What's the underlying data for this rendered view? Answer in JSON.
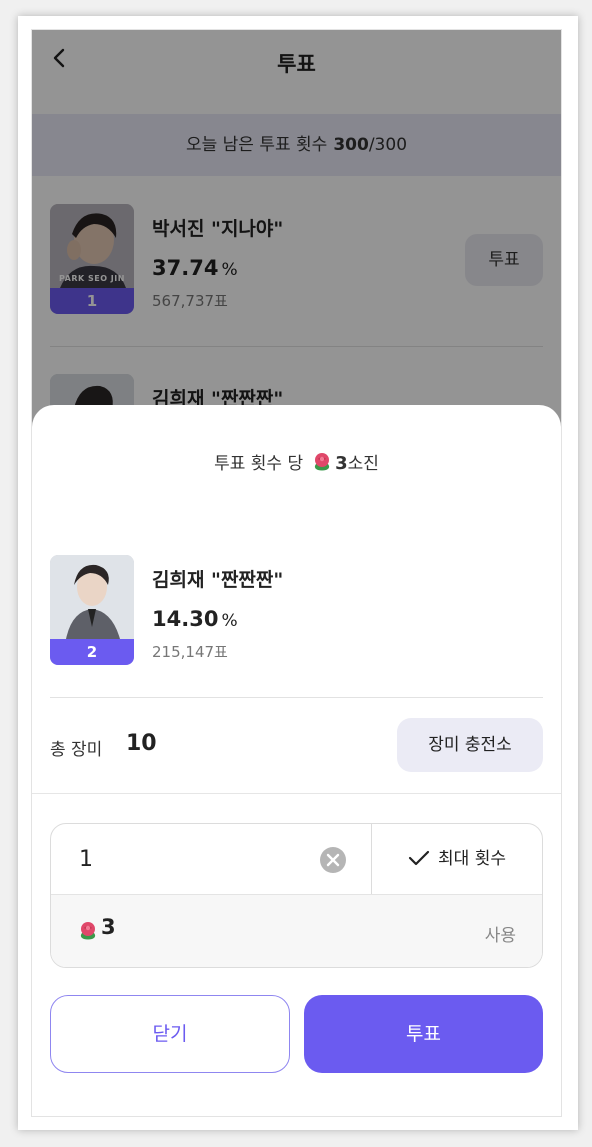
{
  "header": {
    "title": "투표"
  },
  "remaining": {
    "label": "오늘 남은 투표 횟수",
    "count": "300",
    "total": "/300"
  },
  "candidates": [
    {
      "name": "박서진 \"지나야\"",
      "percent": "37.74",
      "unit": "%",
      "votes": "567,737표",
      "rank": "1",
      "caption": "PARK SEO JIN",
      "vote_label": "투표"
    },
    {
      "name": "김희재 \"짠짠짠\"",
      "percent": "14.30",
      "unit": "%",
      "votes": "215,147표",
      "rank": "2"
    }
  ],
  "sheet": {
    "cost_prefix": "투표 횟수 당",
    "cost_value": "3",
    "cost_suffix": "소진",
    "total_label": "총 장미",
    "total_value": "10",
    "charge_label": "장미 충전소",
    "quantity_value": "1",
    "max_label": "최대 횟수",
    "use_amount": "3",
    "use_label": "사용",
    "close_label": "닫기",
    "vote_label": "투표"
  },
  "colors": {
    "accent": "#6b5bf0",
    "rose": "#e0486a"
  },
  "icons": [
    "back-chevron-icon",
    "rose-icon",
    "clear-icon",
    "check-icon"
  ]
}
